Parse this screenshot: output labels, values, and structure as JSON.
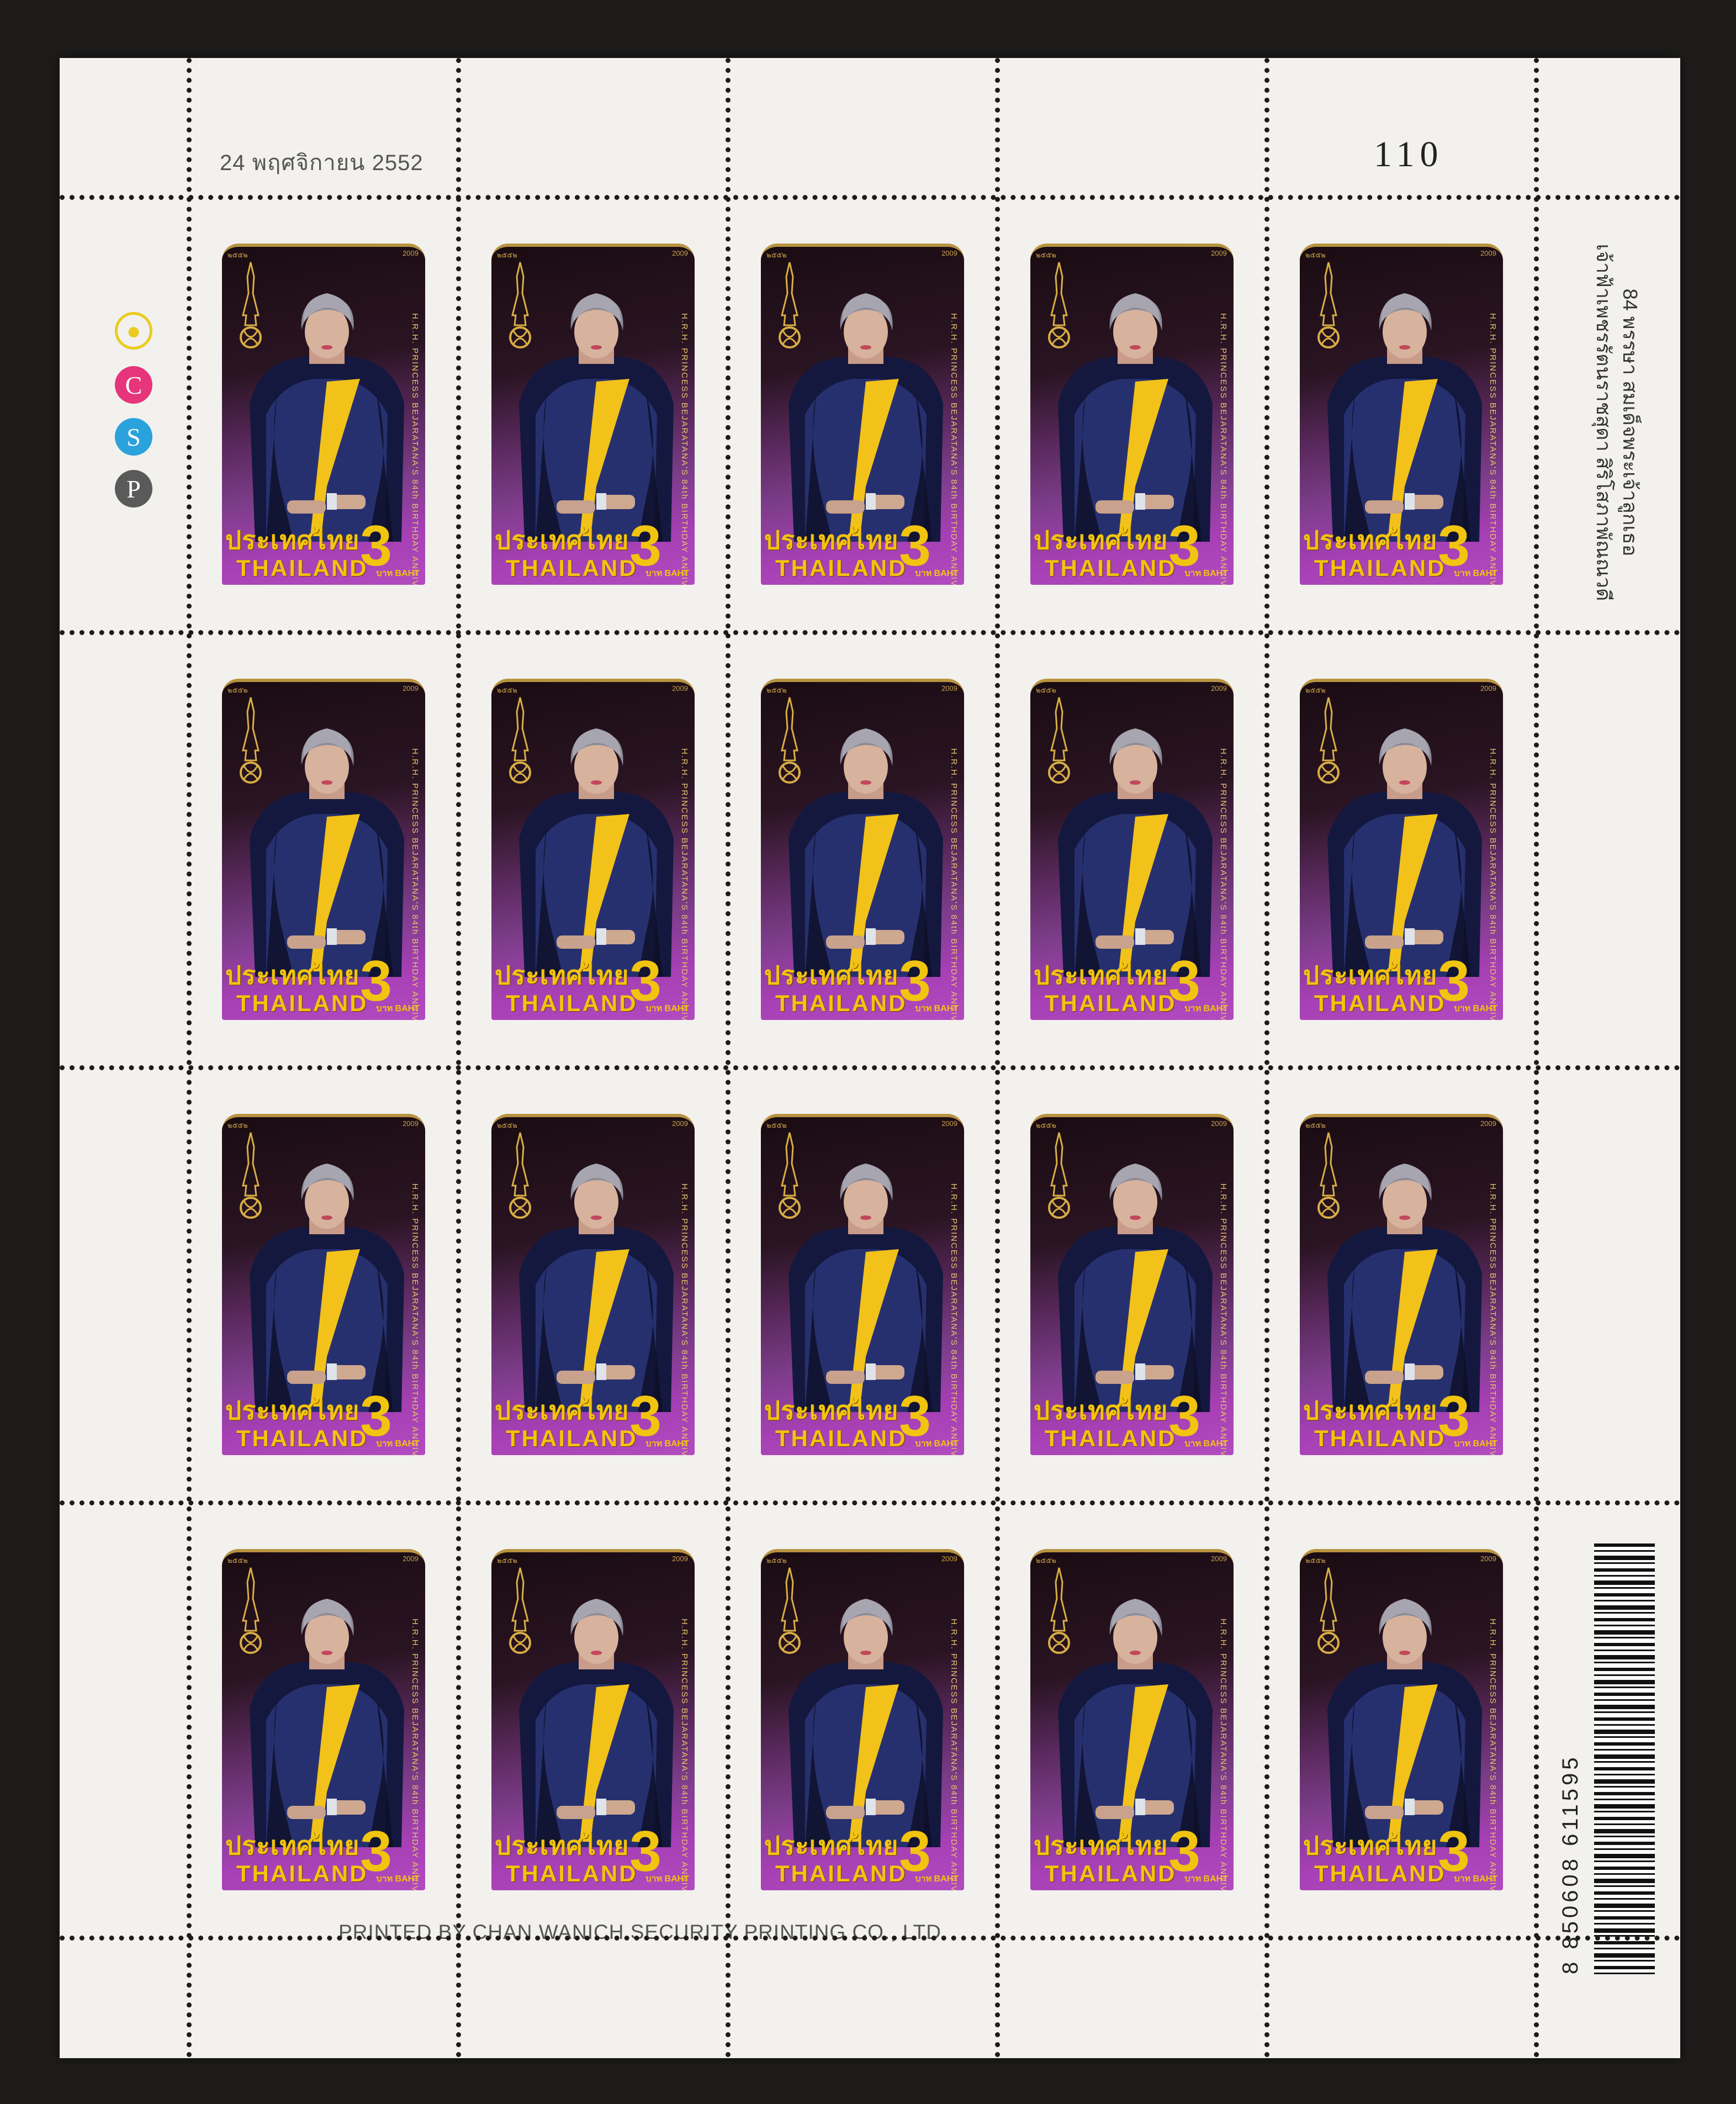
{
  "sheet": {
    "date_text": "24 พฤศจิกายน 2552",
    "sheet_number": "110",
    "color_marks": [
      "C",
      "S",
      "P"
    ],
    "side_title_lines": [
      "84 พรรษา สมเด็จพระเจ้าลูกเธอ",
      "เจ้าฟ้าเพชรรัตนราชสุดา สิริโสภาพัณณวดี"
    ],
    "barcode_digits": "8 850608 611595",
    "printer_text": "PRINTED BY   CHAN  WANICH  SECURITY  PRINTING CO., LTD."
  },
  "stamp": {
    "country_thai": "ประเทศไทย",
    "country_en": "THAILAND",
    "value": "3",
    "unit": "บาท BAHT",
    "caption": "H.R.H. PRINCESS BEJARATANA'S 84th BIRTHDAY ANNIVERSARY",
    "year_thai": "๒๕๕๒",
    "year": "2009"
  },
  "colors": {
    "sheet": "#f2f1ee",
    "background": "#1d1c1b",
    "stamp_purple": "#a53fb3",
    "gold": "#f1c40f"
  }
}
